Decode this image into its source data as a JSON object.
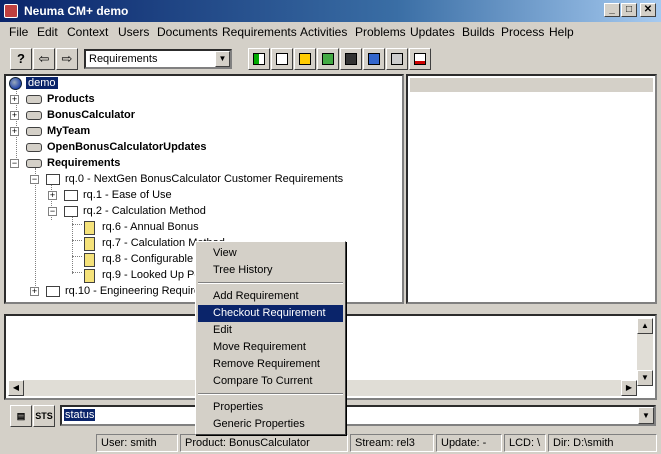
{
  "window": {
    "title": "Neuma CM+ demo",
    "controls": {
      "minimize": "_",
      "maximize": "□",
      "close": "✕"
    }
  },
  "menubar": [
    "File",
    "Edit",
    "Context",
    "Users",
    "Documents",
    "Requirements",
    "Activities",
    "Problems",
    "Updates",
    "Builds",
    "Process",
    "Help"
  ],
  "toolbar": {
    "help_icon": "?",
    "back_icon": "⇦",
    "forward_icon": "⇨",
    "context_select": "Requirements"
  },
  "tree": {
    "root": "demo",
    "top_level": [
      "Products",
      "BonusCalculator",
      "MyTeam",
      "OpenBonusCalculatorUpdates",
      "Requirements"
    ],
    "rq0": "rq.0 - NextGen BonusCalculator Customer Requirements",
    "rq1": "rq.1 - Ease of Use",
    "rq2": "rq.2 - Calculation Method",
    "rq6": "rq.6 - Annual Bonus",
    "rq7": "rq.7 - Calculation Method",
    "rq8": "rq.8 - Configurable",
    "rq9": "rq.9 - Looked Up Pe",
    "rq10": "rq.10 - Engineering Require"
  },
  "context_menu": {
    "items": [
      "View",
      "Tree History",
      "Add Requirement",
      "Checkout Requirement",
      "Edit",
      "Move Requirement",
      "Remove Requirement",
      "Compare To Current",
      "Properties",
      "Generic Properties"
    ],
    "highlighted": "Checkout Requirement"
  },
  "command": {
    "icon_label": "STS",
    "value": "status"
  },
  "statusbar": {
    "user": "User: smith",
    "product": "Product: BonusCalculator",
    "stream": "Stream: rel3",
    "update": "Update: -",
    "lcd": "LCD: \\",
    "dir": "Dir: D:\\smith"
  }
}
